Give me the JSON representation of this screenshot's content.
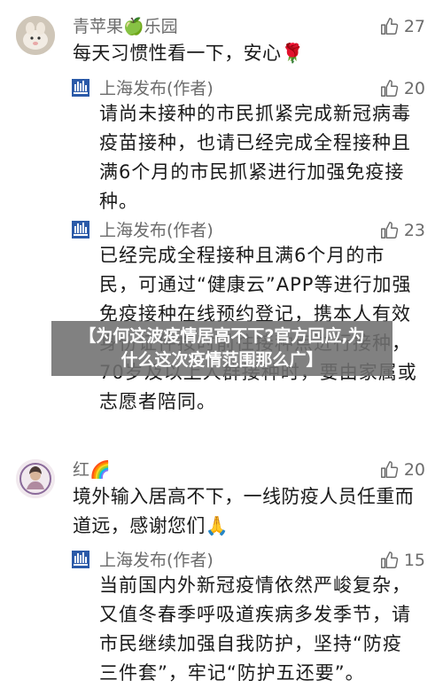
{
  "comments": [
    {
      "username": "青苹果🍏乐园",
      "likes": "27",
      "text": "每天习惯性看一下，安心🌹",
      "replies": [
        {
          "author": "上海发布(作者)",
          "likes": "20",
          "text": "请尚未接种的市民抓紧完成新冠病毒疫苗接种，也请已经完成全程接种且满6个月的市民抓紧进行加强免疫接种。"
        },
        {
          "author": "上海发布(作者)",
          "likes": "23",
          "text": "已经完成全程接种且满6个月的市民，可通过“健康云”APP等进行加强免疫接种在线预约登记，携本人有效身份证件按时前往接种点进行接种，70岁及以上人群接种时，要由家属或志愿者陪同。"
        }
      ]
    },
    {
      "username": "红🌈",
      "likes": "20",
      "text": "境外输入居高不下，一线防疫人员任重而道远，感谢您们🙏",
      "replies": [
        {
          "author": "上海发布(作者)",
          "likes": "15",
          "text": "当前国内外新冠疫情依然严峻复杂，又值冬春季呼吸道疾病多发季节，请市民继续加强自我防护，坚持“防疫三件套”，牢记“防护五还要”。"
        }
      ]
    }
  ],
  "banner": {
    "line1": "【为何这波疫情居高不下?官方回应,为",
    "line2": "什么这次疫情范围那么广】"
  },
  "colors": {
    "meta_gray": "#6c6c6c",
    "text": "#1a1a1a",
    "banner_bg": "#707070",
    "logo_blue": "#2b5aa8"
  }
}
